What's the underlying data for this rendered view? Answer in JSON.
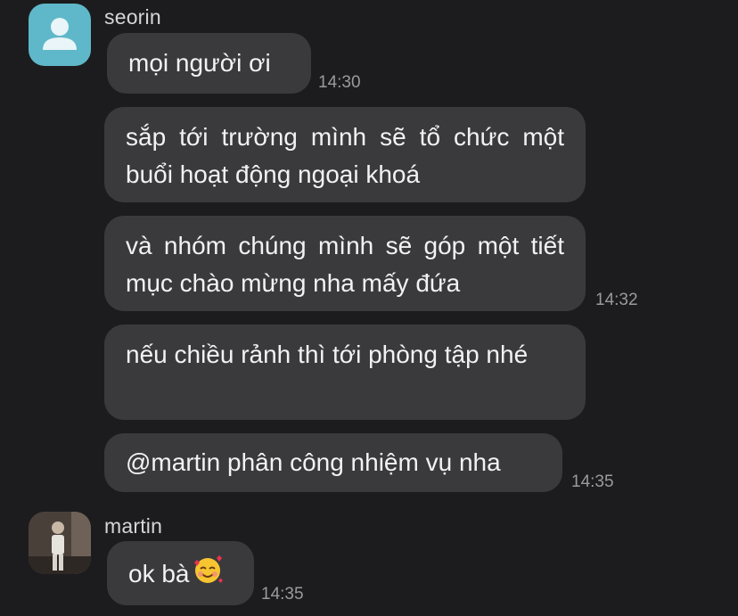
{
  "messages": [
    {
      "sender": "seorin",
      "avatar_icon": "user-silhouette-icon",
      "bubbles": [
        {
          "text": "mọi người ơi",
          "time": "14:30"
        },
        {
          "text": "sắp tới trường mình sẽ tổ chức một buổi hoạt động ngoại khoá",
          "time": ""
        },
        {
          "text": "và nhóm chúng mình sẽ góp một tiết mục chào mừng nha mấy đứa",
          "time": "14:32"
        },
        {
          "text": "nếu chiều rảnh thì tới phòng tập nhé",
          "time": ""
        },
        {
          "text": "@martin phân công nhiệm vụ nha",
          "time": "14:35"
        }
      ]
    },
    {
      "sender": "martin",
      "avatar_icon": "profile-photo",
      "bubbles": [
        {
          "text": "ok bà",
          "emoji": "smiling-face-with-hearts-icon",
          "time": "14:35"
        }
      ]
    }
  ],
  "colors": {
    "background": "#1c1c1e",
    "bubble": "#3a3a3c",
    "avatar_seorin": "#5fb8c9",
    "time_text": "#9a9a9c"
  }
}
